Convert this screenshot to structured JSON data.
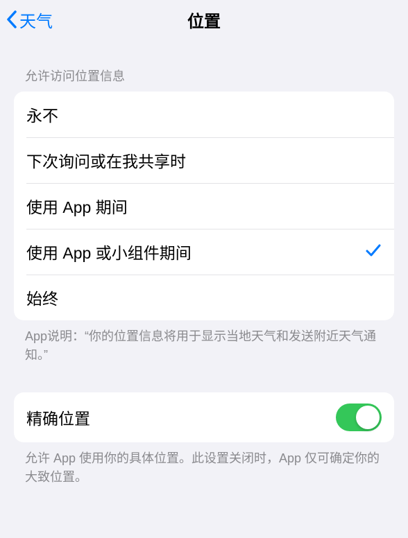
{
  "navbar": {
    "back_label": "天气",
    "title": "位置"
  },
  "section_access": {
    "header": "允许访问位置信息",
    "options": [
      {
        "label": "永不",
        "selected": false
      },
      {
        "label": "下次询问或在我共享时",
        "selected": false
      },
      {
        "label": "使用 App 期间",
        "selected": false
      },
      {
        "label": "使用 App 或小组件期间",
        "selected": true
      },
      {
        "label": "始终",
        "selected": false
      }
    ],
    "footer": "App说明：“你的位置信息将用于显示当地天气和发送附近天气通知。”"
  },
  "section_precise": {
    "label": "精确位置",
    "on": true,
    "footer": "允许 App 使用你的具体位置。此设置关闭时，App 仅可确定你的大致位置。"
  }
}
